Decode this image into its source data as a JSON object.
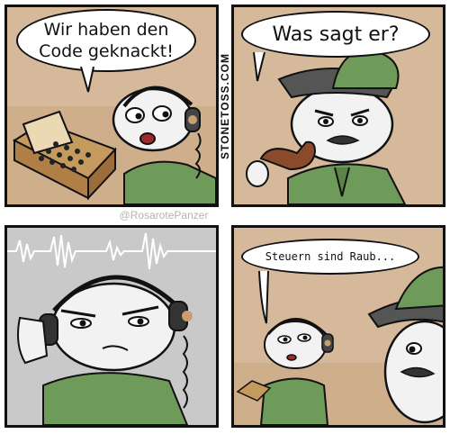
{
  "panels": [
    {
      "dialogue": "Wir haben den\nCode geknackt!"
    },
    {
      "dialogue": "Was sagt er?"
    },
    {
      "dialogue": ""
    },
    {
      "dialogue": "Steuern sind Raub..."
    }
  ],
  "credits": {
    "site": "STONETOSS.COM",
    "user": "@RosarotePanzer"
  },
  "colors": {
    "background": "#d6b99a",
    "uniform": "#6e9a5a",
    "skin": "#f2f2f2",
    "outline": "#111111"
  }
}
